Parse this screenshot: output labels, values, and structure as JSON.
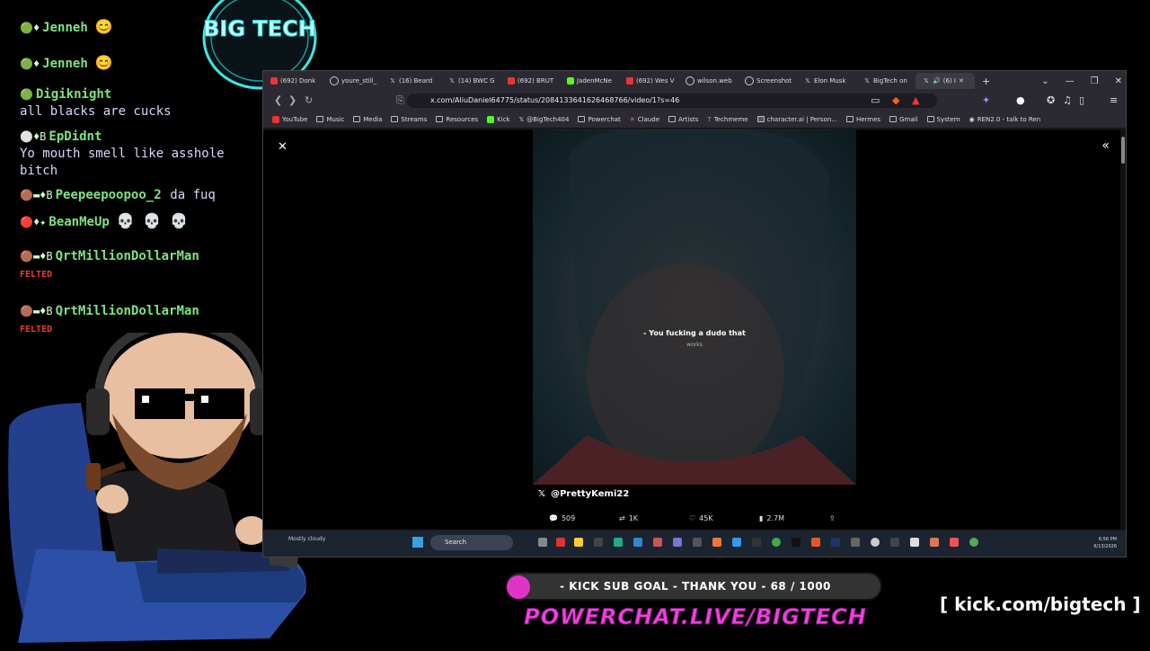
{
  "chat": [
    {
      "user": "Jenneh",
      "text": "",
      "emote": "😊"
    },
    {
      "user": "Jenneh",
      "text": "",
      "emote": "😊"
    },
    {
      "user": "Digiknight",
      "text": "all blacks are cucks"
    },
    {
      "user": "EpDidnt",
      "text": "Yo mouth smell like asshole",
      "text2": "bitch"
    },
    {
      "user": "Peepeepoopoo_2",
      "text": "da fuq"
    },
    {
      "user": "BeanMeUp",
      "text": "",
      "emote": "💀 💀 💀"
    },
    {
      "user": "QrtMillionDollarMan",
      "text": "",
      "felted": "FELTED"
    },
    {
      "user": "QrtMillionDollarMan",
      "text": "",
      "felted": "FELTED"
    }
  ],
  "badge_letter": "B",
  "logo": {
    "text": "BIG TECH"
  },
  "browser": {
    "tabs": [
      {
        "label": "(692) Donk",
        "color": "#e33"
      },
      {
        "label": "youre_still_",
        "color": "#ccc"
      },
      {
        "label": "(16) Beard",
        "color": "#fff"
      },
      {
        "label": "(14) BWC G",
        "color": "#fff"
      },
      {
        "label": "(692) BRUT",
        "color": "#e33"
      },
      {
        "label": "JadenMcNe",
        "color": "#53fc18"
      },
      {
        "label": "(692) Wes V",
        "color": "#e33"
      },
      {
        "label": "wilson.web",
        "color": "#ccc"
      },
      {
        "label": "Screenshot",
        "color": "#ccc"
      },
      {
        "label": "Elon Musk",
        "color": "#fff"
      },
      {
        "label": "BigTech on",
        "color": "#fff"
      },
      {
        "label": "(6) I",
        "color": "#fff"
      }
    ],
    "url": "x.com/AliuDaniel64775/status/2084133641626468766/video/1?s=46",
    "bookmarks": [
      "YouTube",
      "Music",
      "Media",
      "Streams",
      "Resources",
      "Kick",
      "@BigTech404",
      "Powerchat",
      "Claude",
      "Artists",
      "Techmeme",
      "character.ai | Person...",
      "Hermes",
      "Gmail",
      "System",
      "REN2.0 - talk to Ren"
    ],
    "video": {
      "subtitle": "- You fucking a dudo that",
      "subtitle2": "works",
      "author": "@PrettyKemi22"
    },
    "actions": {
      "replies": "509",
      "reposts": "1K",
      "likes": "45K",
      "views": "2.7M"
    },
    "taskbar": {
      "weather": "Mostly cloudy",
      "search": "Search",
      "time": "6:56 PM",
      "date": "6/13/2026"
    }
  },
  "overlay": {
    "subgoal": "- KICK SUB GOAL - THANK YOU - 68 / 1000",
    "powerchat": "POWERCHAT.LIVE/BIGTECH",
    "kickurl": "[ kick.com/bigtech ]"
  },
  "colors": {
    "accent_pink": "#f43ee0",
    "kick_green": "#53fc18",
    "felted_red": "#e0442a"
  }
}
